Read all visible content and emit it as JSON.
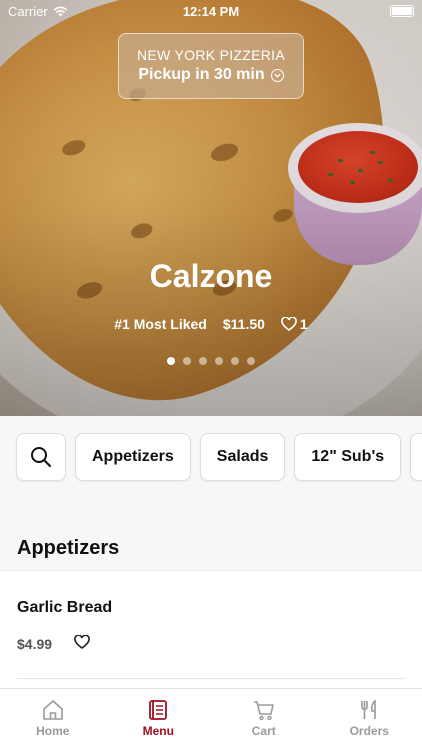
{
  "status_bar": {
    "carrier": "Carrier",
    "time": "12:14 PM"
  },
  "restaurant": {
    "name": "NEW YORK PIZZERIA",
    "pickup": "Pickup in 30 min"
  },
  "featured": {
    "title": "Calzone",
    "rank": "#1 Most Liked",
    "price": "$11.50",
    "likes": "1",
    "slides_total": 6,
    "slide_active": 1
  },
  "categories": [
    "Appetizers",
    "Salads",
    "12\" Sub's"
  ],
  "section": {
    "title": "Appetizers"
  },
  "menu_items": [
    {
      "name": "Garlic Bread",
      "price": "$4.99"
    }
  ],
  "tabs": [
    {
      "label": "Home",
      "icon": "home-icon"
    },
    {
      "label": "Menu",
      "icon": "menu-icon"
    },
    {
      "label": "Cart",
      "icon": "cart-icon"
    },
    {
      "label": "Orders",
      "icon": "fork-knife-icon"
    }
  ],
  "colors": {
    "accent": "#a01020",
    "inactive": "#9a9a9a"
  }
}
